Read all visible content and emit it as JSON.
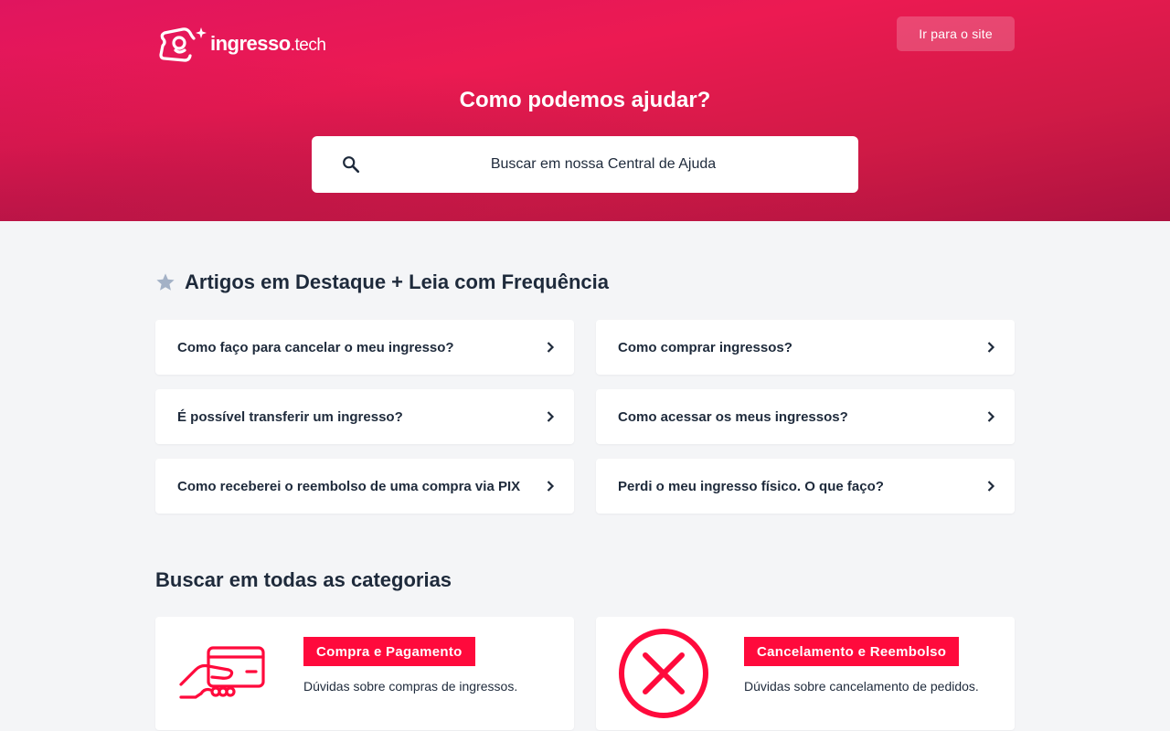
{
  "header": {
    "logo_text": "ingresso",
    "logo_suffix": ".tech",
    "site_button": "Ir para o site",
    "title": "Como podemos ajudar?"
  },
  "search": {
    "placeholder": "Buscar em nossa Central de Ajuda"
  },
  "featured": {
    "title": "Artigos em Destaque + Leia com Frequência",
    "articles": [
      {
        "label": "Como faço para cancelar o meu ingresso?"
      },
      {
        "label": "Como comprar ingressos?"
      },
      {
        "label": "É possível transferir um ingresso?"
      },
      {
        "label": "Como acessar os meus ingressos?"
      },
      {
        "label": "Como receberei o reembolso de uma compra via PIX"
      },
      {
        "label": "Perdi o meu ingresso físico. O que faço?"
      }
    ]
  },
  "categories": {
    "title": "Buscar em todas as categorias",
    "items": [
      {
        "name": "Compra e Pagamento",
        "description": "Dúvidas sobre compras de ingressos.",
        "icon": "card-in-hand-icon"
      },
      {
        "name": "Cancelamento e Reembolso",
        "description": "Dúvidas sobre cancelamento de pedidos.",
        "icon": "cancel-circle-icon"
      }
    ]
  },
  "colors": {
    "brand": "#ec1a52",
    "accent": "#ff0a3c",
    "text": "#1e2a3b",
    "background": "#f4f5f7"
  }
}
